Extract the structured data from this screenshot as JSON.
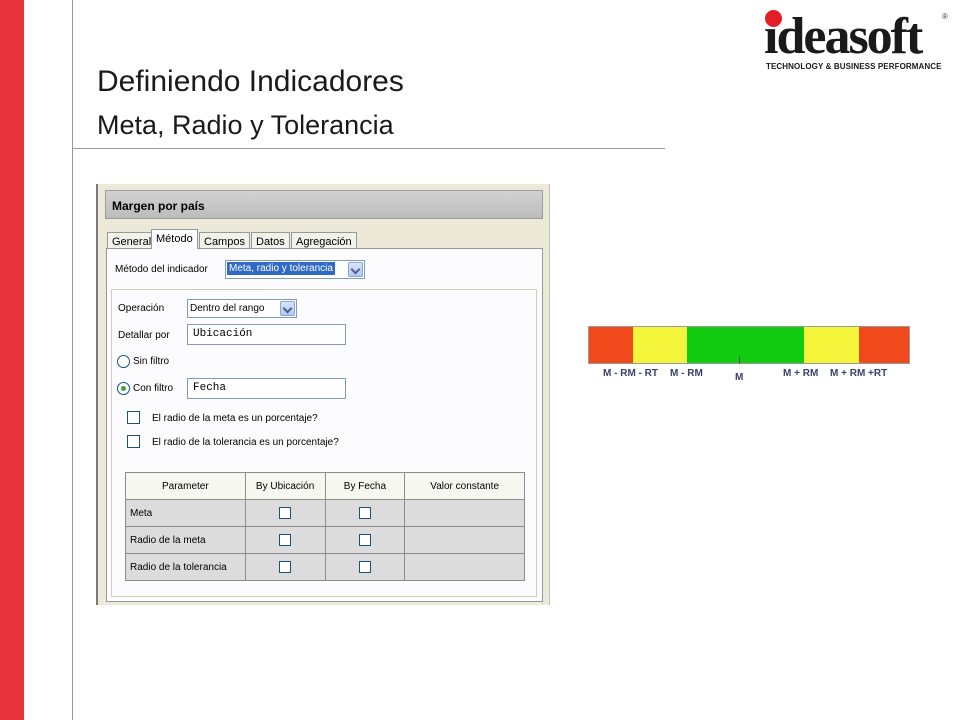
{
  "slide": {
    "title": "Definiendo Indicadores",
    "subtitle": "Meta, Radio y Tolerancia"
  },
  "logo": {
    "wordmark": "ideasoft",
    "registered": "®",
    "tagline": "TECHNOLOGY & BUSINESS PERFORMANCE"
  },
  "dialog": {
    "title": "Margen por país",
    "tabs": [
      {
        "label": "General",
        "active": false
      },
      {
        "label": "Método",
        "active": true
      },
      {
        "label": "Campos",
        "active": false
      },
      {
        "label": "Datos",
        "active": false
      },
      {
        "label": "Agregación",
        "active": false
      }
    ],
    "metodo_label": "Método del indicador",
    "metodo_value": "Meta, radio y tolerancia",
    "operacion_label": "Operación",
    "operacion_value": "Dentro del rango",
    "detallar_label": "Detallar por",
    "detallar_value": "Ubicación",
    "sin_filtro_label": "Sin filtro",
    "con_filtro_label": "Con filtro",
    "con_filtro_value": "Fecha",
    "filter_selected": "con_filtro",
    "check_meta_label": "El radio de la meta es un porcentaje?",
    "check_tol_label": "El radio de la tolerancia es un porcentaje?",
    "grid": {
      "headers": [
        "Parameter",
        "By Ubicación",
        "By Fecha",
        "Valor constante"
      ],
      "rows": [
        {
          "param": "Meta"
        },
        {
          "param": "Radio de la meta"
        },
        {
          "param": "Radio de la tolerancia"
        }
      ]
    }
  },
  "scale": {
    "colors": {
      "red": "#f04a1c",
      "yellow": "#f5f53c",
      "green": "#12cc12"
    },
    "labels": [
      "M - RM - RT",
      "M - RM",
      "M",
      "M + RM",
      "M + RM +RT"
    ]
  },
  "colors": {
    "accent_red": "#e8323c",
    "selection_blue": "#316ac5"
  }
}
